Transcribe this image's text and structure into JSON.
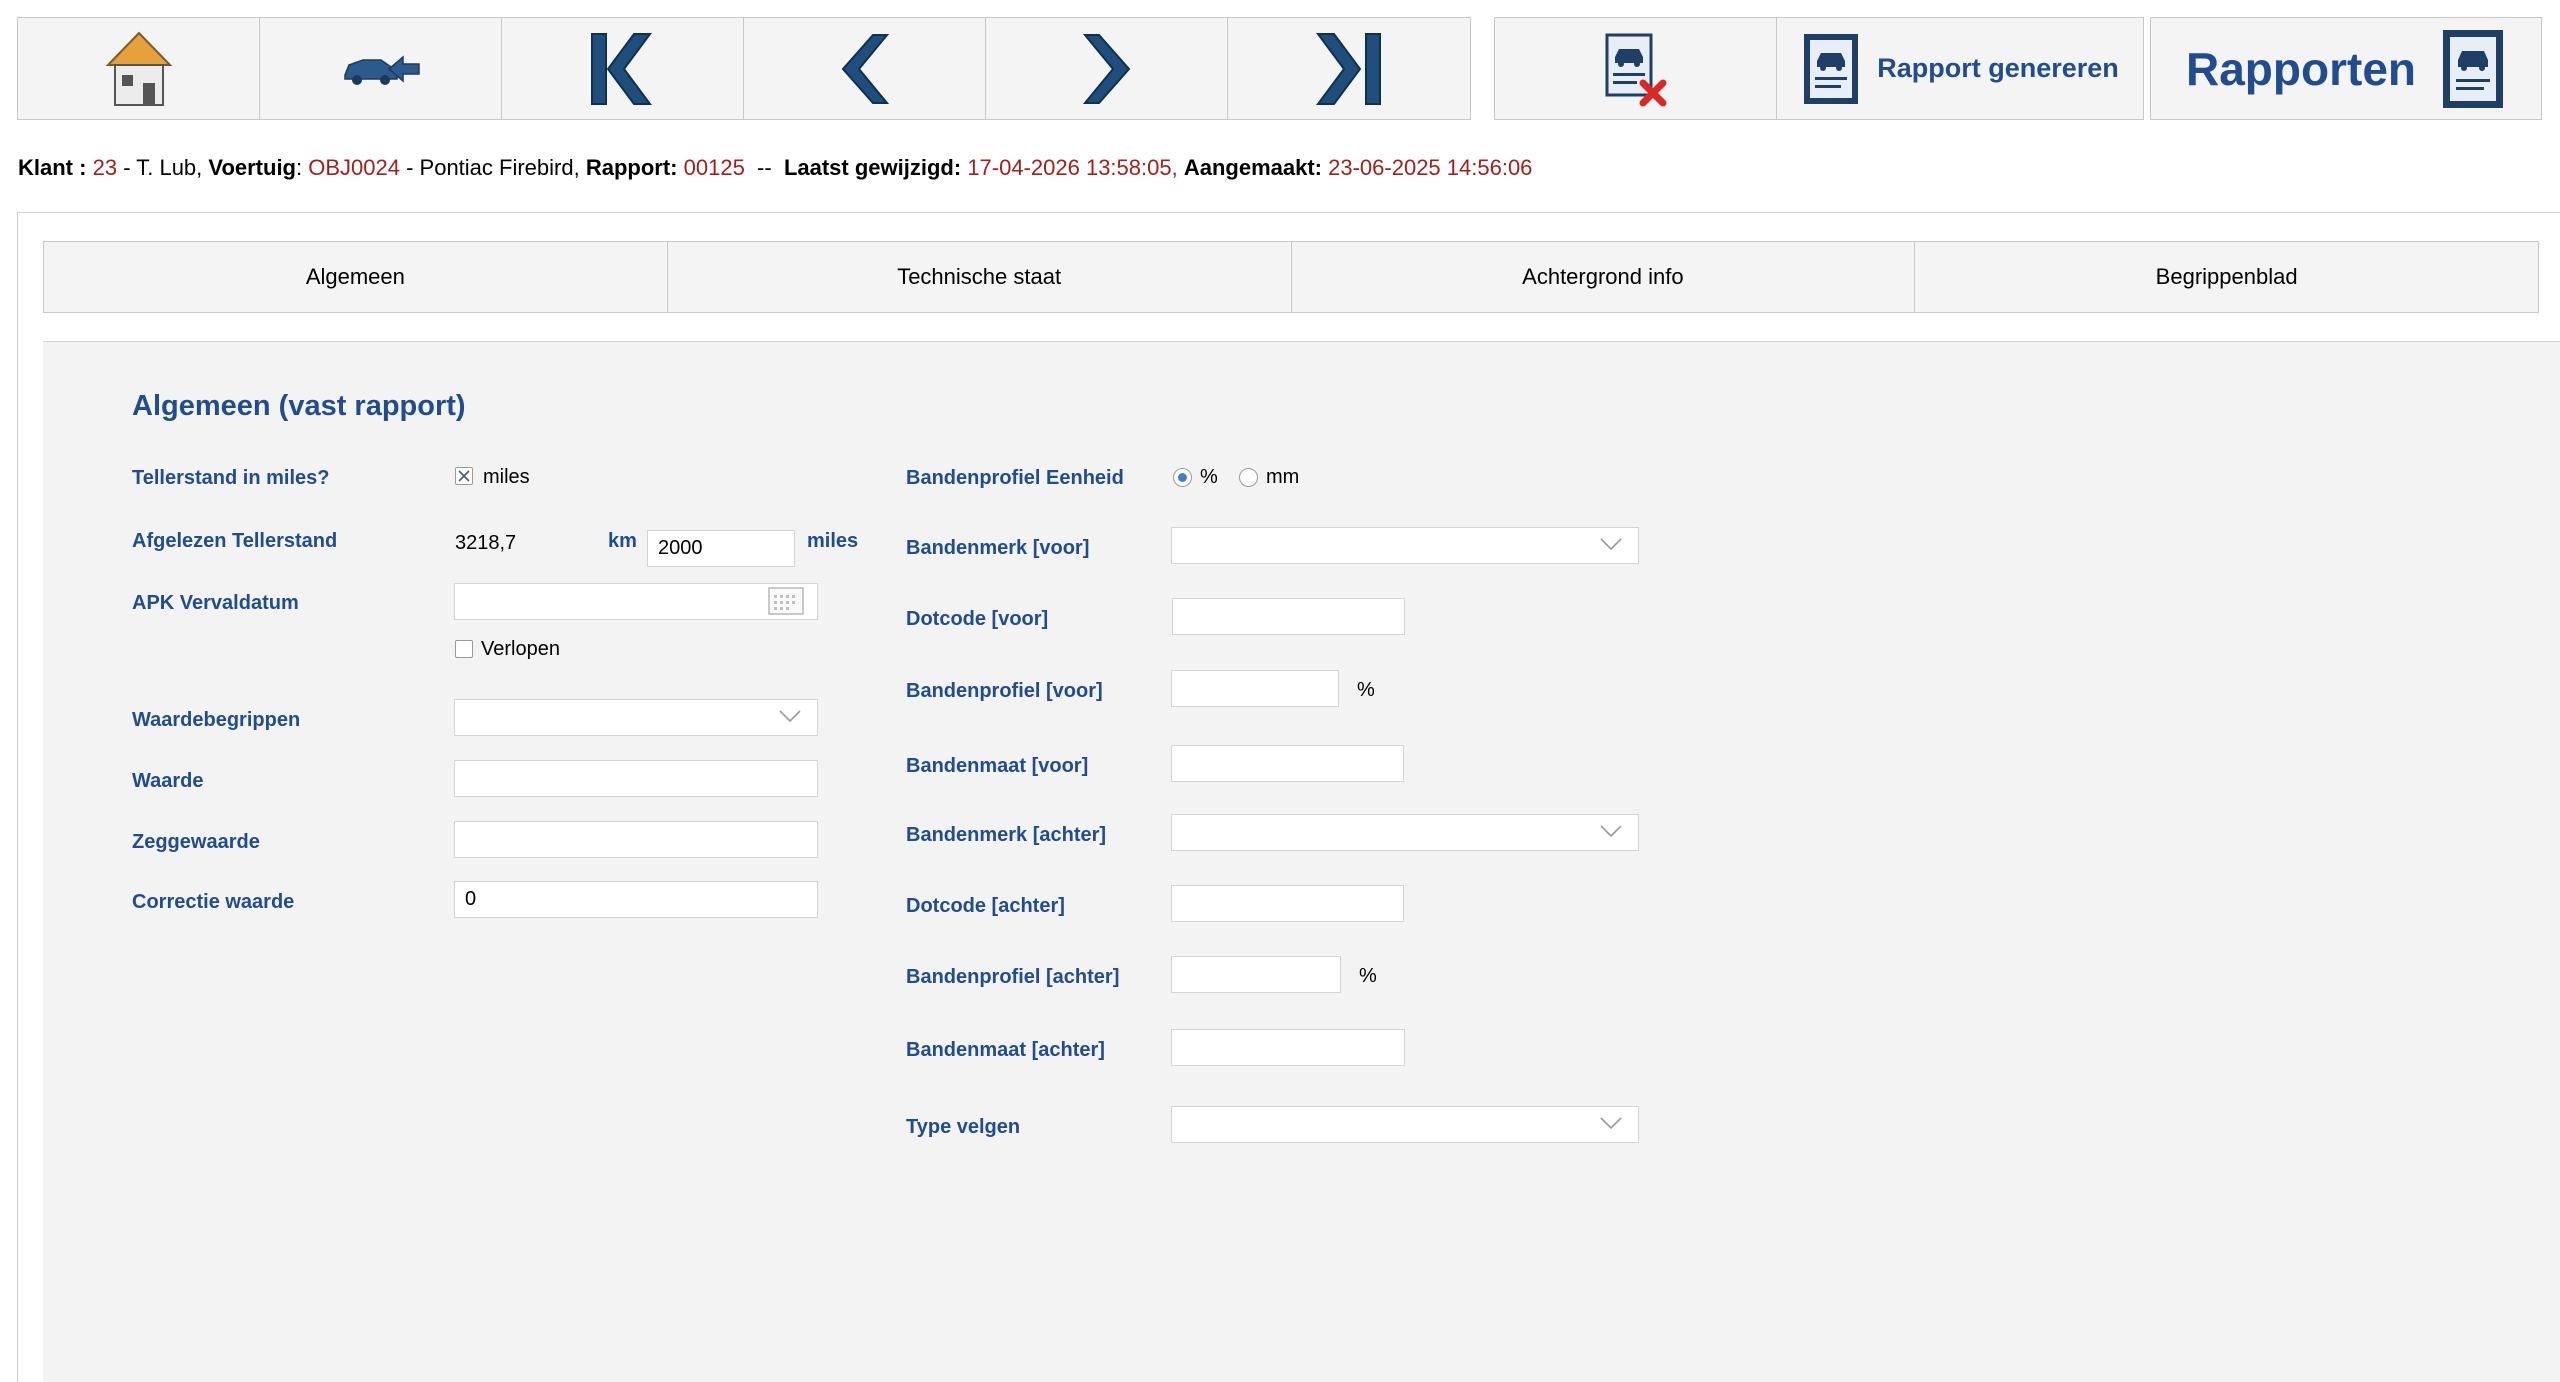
{
  "toolbar": {
    "generate_label": "Rapport genereren",
    "reports_label": "Rapporten",
    "icons": [
      "home-icon",
      "back-car-icon",
      "first-record-icon",
      "previous-record-icon",
      "next-record-icon",
      "last-record-icon",
      "delete-report-icon",
      "report-icon"
    ]
  },
  "info": {
    "klant_label": "Klant :",
    "klant_id": "23",
    "klant_name": "- T. Lub,",
    "voertuig_label": "Voertuig",
    "voertuig_id": "OBJ0024",
    "voertuig_name": "- Pontiac Firebird,",
    "rapport_label": "Rapport:",
    "rapport_id": "00125",
    "separator": "--",
    "gewijzigd_label": "Laatst gewijzigd:",
    "gewijzigd_value": "17-04-2026 13:58:05,",
    "aangemaakt_label": "Aangemaakt:",
    "aangemaakt_value": "23-06-2025 14:56:06"
  },
  "tabs": [
    "Algemeen",
    "Technische staat",
    "Achtergrond info",
    "Begrippenblad"
  ],
  "form": {
    "title": "Algemeen (vast rapport)",
    "left": {
      "tellerstand_miles_label": "Tellerstand in miles?",
      "tellerstand_miles_option": "miles",
      "afgelezen_label": "Afgelezen Tellerstand",
      "afgelezen_km_value": "3218,7",
      "km_unit": "km",
      "miles_value": "2000",
      "miles_unit": "miles",
      "apk_label": "APK Vervaldatum",
      "apk_value": "",
      "verlopen_label": "Verlopen",
      "waardebegrippen_label": "Waardebegrippen",
      "waarde_label": "Waarde",
      "waarde_value": "",
      "zeggewaarde_label": "Zeggewaarde",
      "zeggewaarde_value": "",
      "correctie_label": "Correctie waarde",
      "correctie_value": "0"
    },
    "right": {
      "eenheid_label": "Bandenprofiel Eenheid",
      "eenheid_opt1": "%",
      "eenheid_opt2": "mm",
      "merk_voor_label": "Bandenmerk [voor]",
      "dot_voor_label": "Dotcode [voor]",
      "profiel_voor_label": "Bandenprofiel [voor]",
      "profiel_voor_unit": "%",
      "maat_voor_label": "Bandenmaat [voor]",
      "merk_achter_label": "Bandenmerk [achter]",
      "dot_achter_label": "Dotcode [achter]",
      "profiel_achter_label": "Bandenprofiel [achter]",
      "profiel_achter_unit": "%",
      "maat_achter_label": "Bandenmaat [achter]",
      "velgen_label": "Type velgen"
    }
  },
  "colors": {
    "accent_blue": "#214c8f",
    "value_red": "#a3201a",
    "panel_bg": "#f3f3f3"
  }
}
